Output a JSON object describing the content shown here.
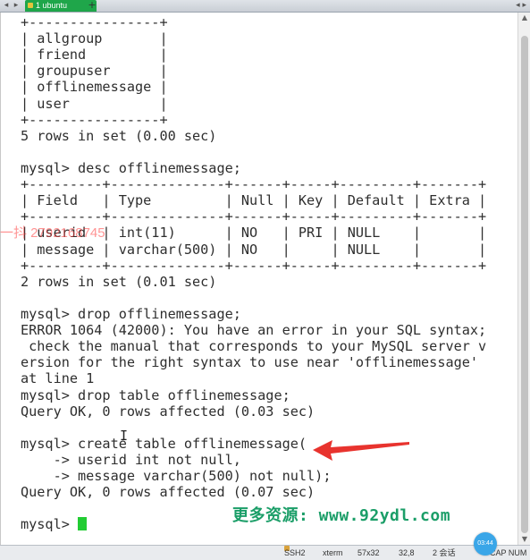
{
  "tabbar": {
    "tab_label": "1 ubuntu",
    "tab_close": "×",
    "new_tab": "+",
    "left_nav": "◂",
    "right_nav": "▸",
    "right_controls": "◂ ▸"
  },
  "terminal": {
    "lines": [
      "+----------------+",
      "| allgroup       |",
      "| friend         |",
      "| groupuser      |",
      "| offlinemessage |",
      "| user           |",
      "+----------------+",
      "5 rows in set (0.00 sec)",
      "",
      "mysql> desc offlinemessage;",
      "+---------+--------------+------+-----+---------+-------+",
      "| Field   | Type         | Null | Key | Default | Extra |",
      "+---------+--------------+------+-----+---------+-------+",
      "| userid  | int(11)      | NO   | PRI | NULL    |       |",
      "| message | varchar(500) | NO   |     | NULL    |       |",
      "+---------+--------------+------+-----+---------+-------+",
      "2 rows in set (0.01 sec)",
      "",
      "mysql> drop offlinemessage;",
      "ERROR 1064 (42000): You have an error in your SQL syntax;",
      " check the manual that corresponds to your MySQL server v",
      "ersion for the right syntax to use near 'offlinemessage'",
      "at line 1",
      "mysql> drop table offlinemessage;",
      "Query OK, 0 rows affected (0.03 sec)",
      "",
      "mysql> create table offlinemessage(",
      "    -> userid int not null,",
      "    -> message varchar(500) not null);",
      "Query OK, 0 rows affected (0.07 sec)",
      "",
      "mysql> "
    ],
    "cursor_color": "#22cc33"
  },
  "statusbar": {
    "ssh": "SSH2",
    "term": "xterm",
    "size": "57x32",
    "position": "32,8",
    "sessions": "2 会话",
    "caps": "CAP NUM",
    "clock": "03:44"
  },
  "overlays": {
    "watermark_left": "一抖  2792168745",
    "watermark_bottom": "更多资源: www.92ydl.com",
    "arrow_color": "#e8332e"
  }
}
